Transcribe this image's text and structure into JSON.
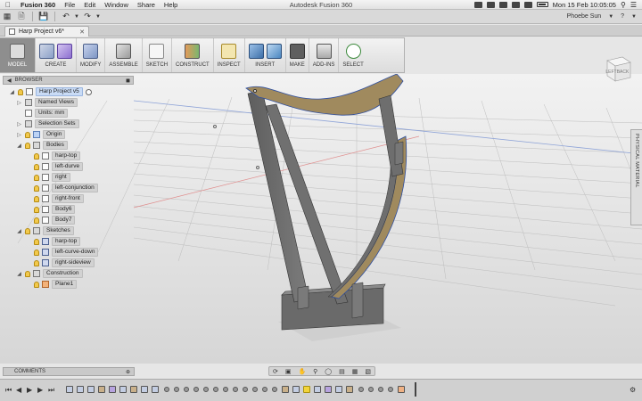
{
  "menubar": {
    "app_name": "Fusion 360",
    "menus": [
      "File",
      "Edit",
      "Window",
      "Share",
      "Help"
    ],
    "window_title": "Autodesk Fusion 360",
    "datetime": "Mon 15 Feb  10:05:05"
  },
  "qab": {
    "user_name": "Phoebe Sun"
  },
  "document": {
    "tab_title": "Harp Project v6*"
  },
  "ribbon": {
    "model": "MODEL",
    "create": "CREATE",
    "modify": "MODIFY",
    "assemble": "ASSEMBLE",
    "sketch": "SKETCH",
    "construct": "CONSTRUCT",
    "inspect": "INSPECT",
    "insert": "INSERT",
    "make": "MAKE",
    "addins": "ADD-INS",
    "select": "SELECT"
  },
  "browser": {
    "header": "BROWSER",
    "root": "Harp Project v5",
    "named_views": "Named Views",
    "units": "Units: mm",
    "selection_sets": "Selection Sets",
    "origin": "Origin",
    "bodies": "Bodies",
    "body_items": [
      "harp-top",
      "left-durve",
      "right",
      "left-conjunction",
      "right-front",
      "Body6",
      "Body7"
    ],
    "sketches": "Sketches",
    "sketch_items": [
      "harp-top",
      "left-curve-down",
      "right-sideview"
    ],
    "construction": "Construction",
    "construction_items": [
      "Plane1"
    ]
  },
  "viewcube": {
    "face_left": "LEFT",
    "face_back": "BACK"
  },
  "physical_material": "PHYSICAL MATERIAL",
  "comments": "COMMENTS",
  "colors": {
    "accent_blue": "#2f6db5",
    "model_body": "#6e6e6e",
    "model_face": "#a08a5e",
    "selection_yellow": "#f2d43b"
  }
}
